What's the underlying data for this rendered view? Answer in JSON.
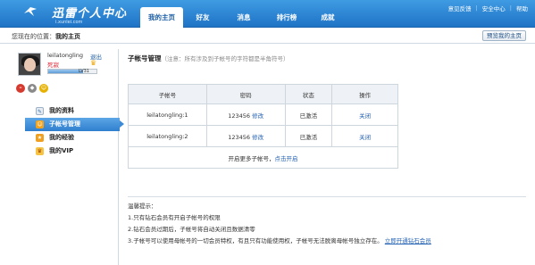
{
  "header": {
    "logo_main": "迅雷个人中心",
    "logo_sub": "i.xunlei.com",
    "tabs": [
      {
        "label": "我的主页",
        "active": true
      },
      {
        "label": "好友",
        "active": false
      },
      {
        "label": "消息",
        "active": false
      },
      {
        "label": "排行榜",
        "active": false
      },
      {
        "label": "成就",
        "active": false
      }
    ],
    "links": [
      "意见反馈",
      "安全中心",
      "帮助"
    ]
  },
  "breadcrumb": {
    "prefix": "您现在的位置：",
    "current": "我的主页",
    "preview_button": "预览我的主页"
  },
  "profile": {
    "username": "leilatongling",
    "logout": "退出",
    "status": "死寂",
    "level": "LV31",
    "level_progress": 0.72
  },
  "side_menu": [
    {
      "label": "我的资料",
      "icon": "profile-icon",
      "active": false
    },
    {
      "label": "子帐号管理",
      "icon": "subaccount-icon",
      "active": true
    },
    {
      "label": "我的经验",
      "icon": "experience-icon",
      "active": false
    },
    {
      "label": "我的VIP",
      "icon": "vip-icon",
      "active": false
    }
  ],
  "main": {
    "title": "子帐号管理",
    "note": "（注意：所有涉及到子帐号的字符都是半角符号）",
    "table": {
      "headers": [
        "子帐号",
        "密码",
        "状态",
        "操作"
      ],
      "rows": [
        {
          "account": "leilatongling:1",
          "password": "123456",
          "edit": "修改",
          "status": "已激活",
          "action": "关闭"
        },
        {
          "account": "leilatongling:2",
          "password": "123456",
          "edit": "修改",
          "status": "已激活",
          "action": "关闭"
        }
      ],
      "footer_text": "开启更多子帐号，",
      "footer_link": "点击开启"
    },
    "tips": {
      "title": "温馨提示：",
      "items": [
        "1.只有钻石会员有开启子帐号的权限",
        "2.钻石会员过期后，子帐号将自动关闭且数据清零",
        "3.子帐号可以使用母帐号的一切会员特权，有且只有功能使用权，子帐号无法脱离母帐号独立存在。"
      ],
      "link": "立即开通钻石会员"
    }
  },
  "colors": {
    "header_blue": "#2a82d2",
    "link_blue": "#2462b4",
    "status_red": "#dd2233"
  }
}
